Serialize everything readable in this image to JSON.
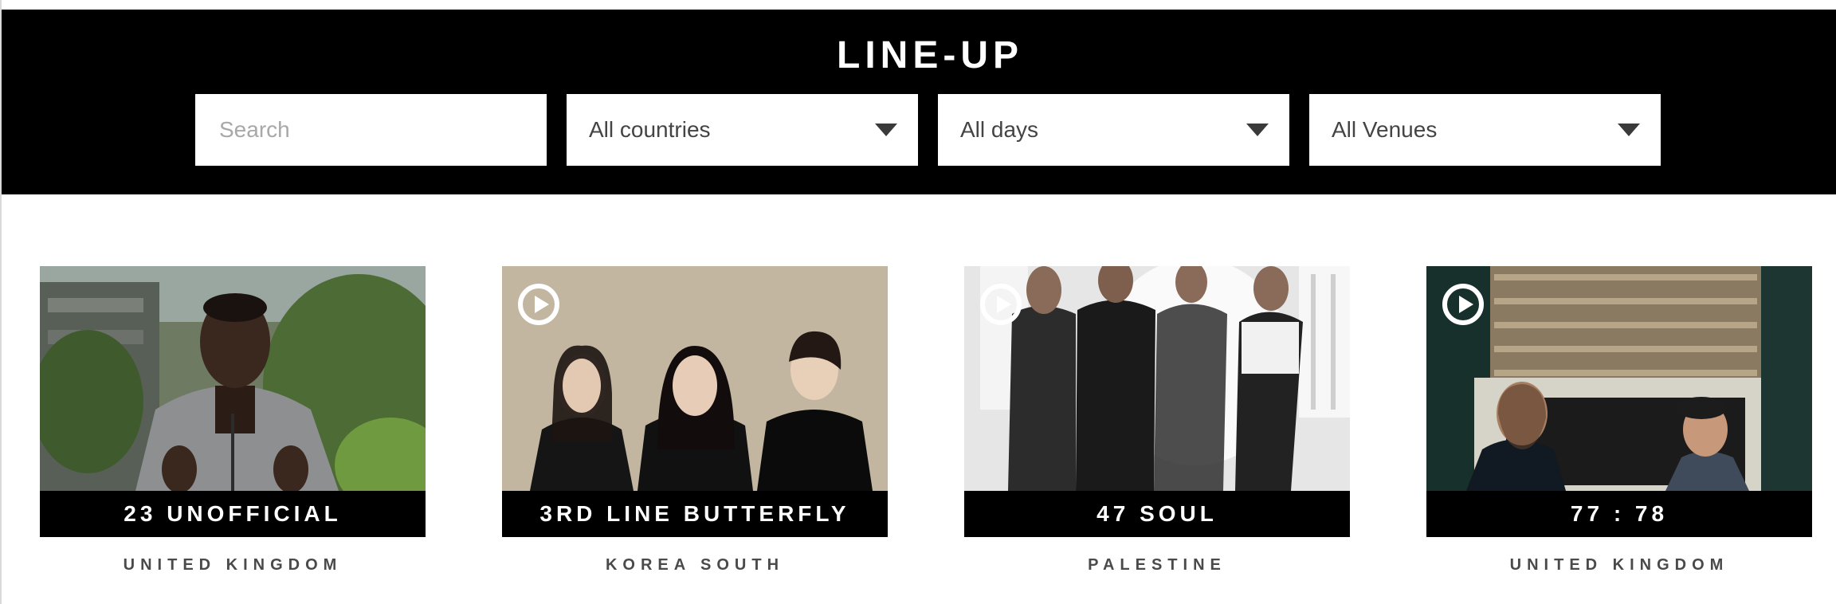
{
  "header": {
    "title": "LINE-UP",
    "search": {
      "placeholder": "Search",
      "value": ""
    },
    "filters": [
      {
        "value": "All countries"
      },
      {
        "value": "All days"
      },
      {
        "value": "All Venues"
      }
    ]
  },
  "artists": [
    {
      "name": "23 UNOFFICIAL",
      "country": "UNITED KINGDOM",
      "has_video": false
    },
    {
      "name": "3RD LINE BUTTERFLY",
      "country": "KOREA SOUTH",
      "has_video": true
    },
    {
      "name": "47 SOUL",
      "country": "PALESTINE",
      "has_video": true
    },
    {
      "name": "77 : 78",
      "country": "UNITED KINGDOM",
      "has_video": true
    }
  ],
  "colors": {
    "header_bg": "#000000",
    "text_on_dark": "#ffffff",
    "country_text": "#4a4a4a"
  },
  "icons": {
    "dropdown": "caret-down-icon",
    "video": "play-icon"
  }
}
